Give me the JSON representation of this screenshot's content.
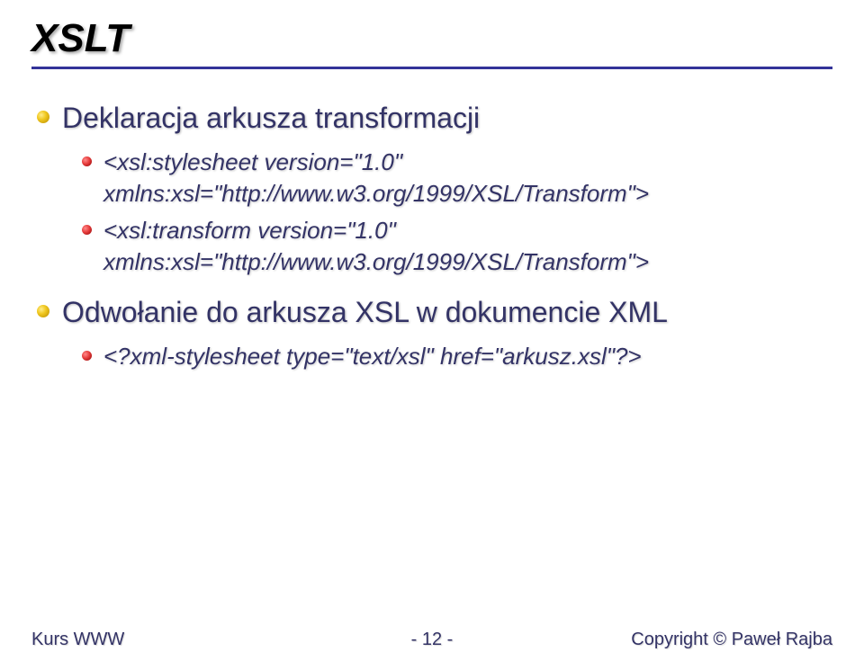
{
  "title": "XSLT",
  "bullets": {
    "b1": {
      "label": "Deklaracja arkusza transformacji",
      "sub": [
        "<xsl:stylesheet version=\"1.0\" xmlns:xsl=\"http://www.w3.org/1999/XSL/Transform\">",
        "<xsl:transform version=\"1.0\" xmlns:xsl=\"http://www.w3.org/1999/XSL/Transform\">"
      ]
    },
    "b2": {
      "label": "Odwołanie do arkusza XSL w dokumencie XML",
      "sub": [
        "<?xml-stylesheet type=\"text/xsl\" href=\"arkusz.xsl\"?>"
      ]
    }
  },
  "footer": {
    "left": "Kurs WWW",
    "center": "- 12 -",
    "right": "Copyright © Paweł Rajba"
  }
}
